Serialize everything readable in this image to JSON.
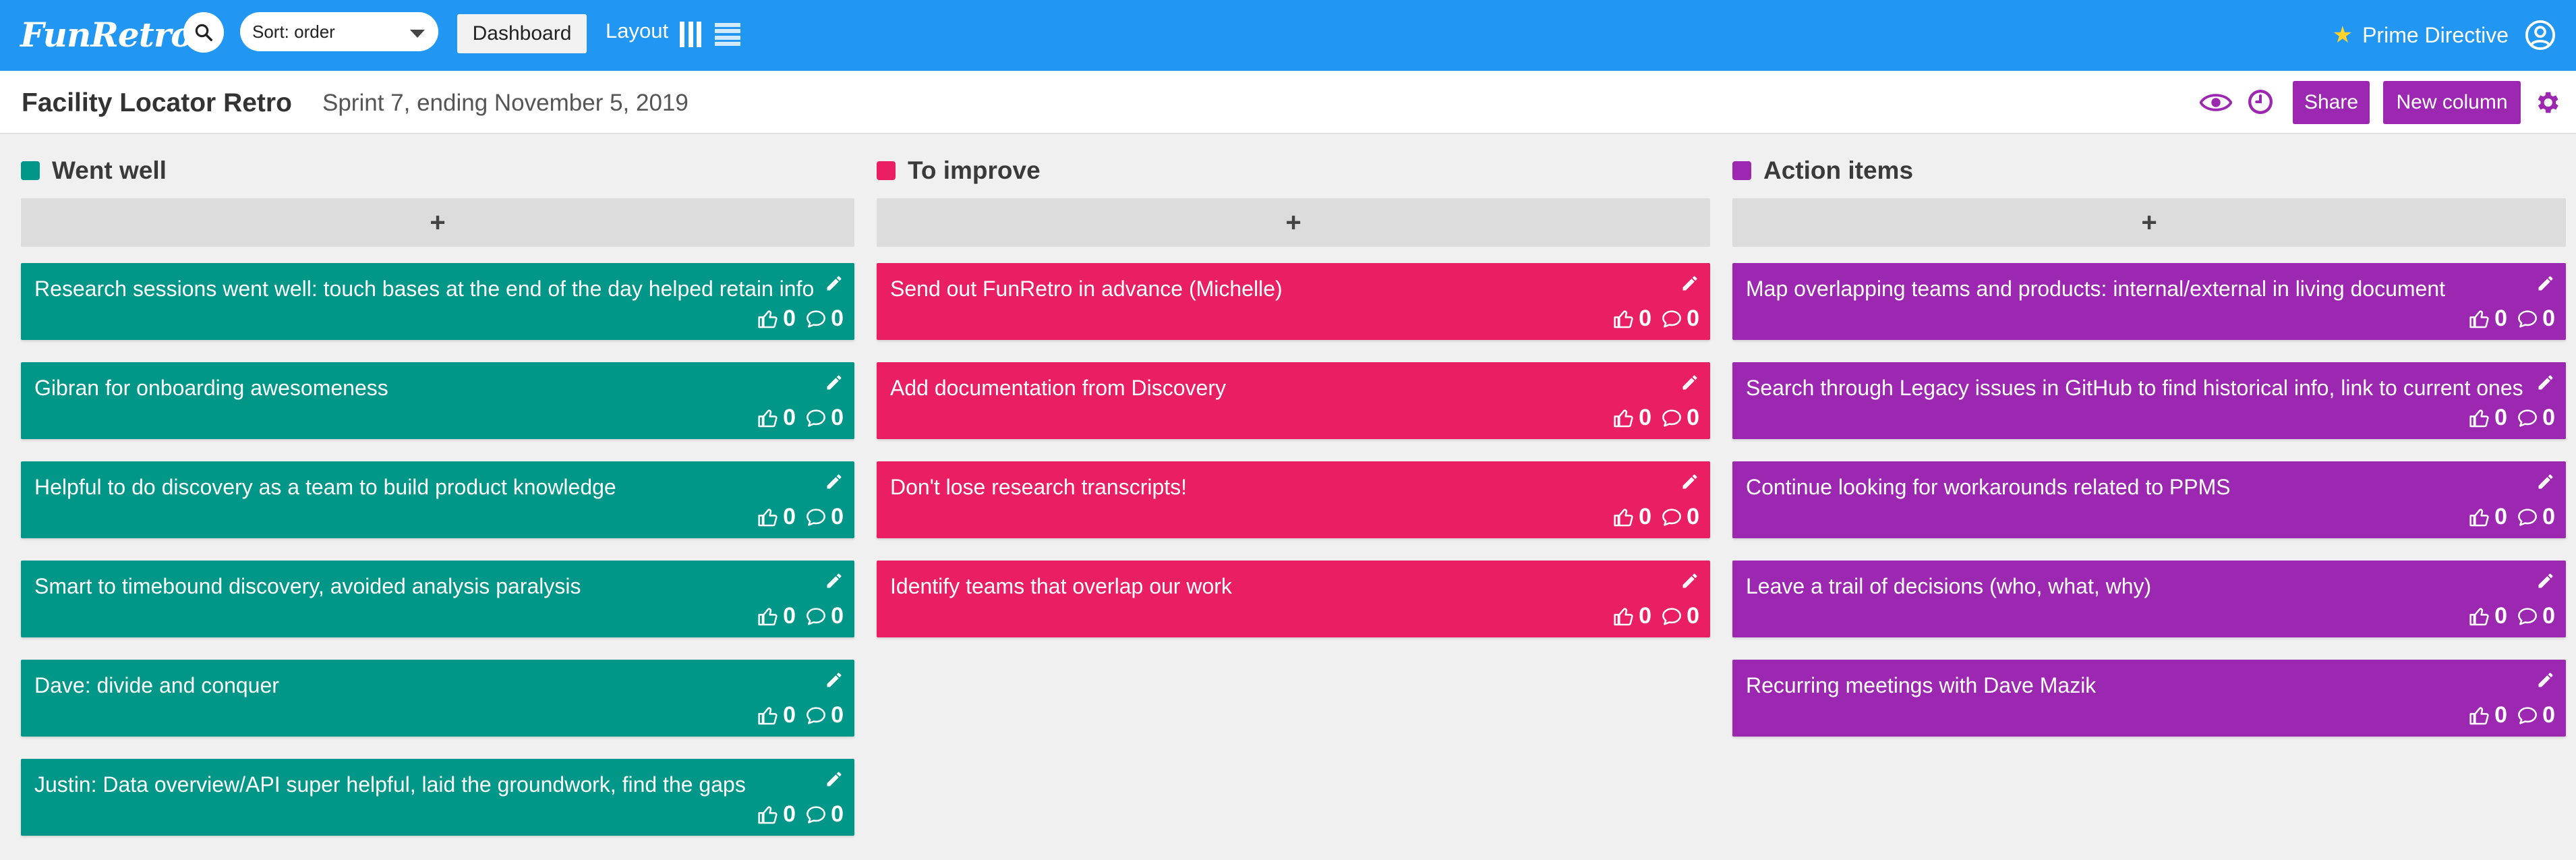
{
  "app": {
    "logo": "FunRetro",
    "sort_value": "Sort: order",
    "dashboard_label": "Dashboard",
    "layout_label": "Layout",
    "prime_directive_label": "Prime Directive"
  },
  "board": {
    "title": "Facility Locator Retro",
    "subtitle": "Sprint 7, ending November 5, 2019",
    "share_label": "Share",
    "new_column_label": "New column"
  },
  "colors": {
    "topbar": "#2196f3",
    "went_well": "#009688",
    "to_improve": "#e91e63",
    "action_items": "#9c27b0"
  },
  "columns": [
    {
      "title": "Went well",
      "color": "#009688",
      "add_label": "+",
      "cards": [
        {
          "text": "Research sessions went well: touch bases at the end of the day helped retain info",
          "votes": "0",
          "comments": "0"
        },
        {
          "text": "Gibran for onboarding awesomeness",
          "votes": "0",
          "comments": "0"
        },
        {
          "text": "Helpful to do discovery as a team to build product knowledge",
          "votes": "0",
          "comments": "0"
        },
        {
          "text": "Smart to timebound discovery, avoided analysis paralysis",
          "votes": "0",
          "comments": "0"
        },
        {
          "text": "Dave: divide and conquer",
          "votes": "0",
          "comments": "0"
        },
        {
          "text": "Justin: Data overview/API super helpful, laid the groundwork, find the gaps",
          "votes": "0",
          "comments": "0"
        }
      ]
    },
    {
      "title": "To improve",
      "color": "#e91e63",
      "add_label": "+",
      "cards": [
        {
          "text": "Send out FunRetro in advance (Michelle)",
          "votes": "0",
          "comments": "0"
        },
        {
          "text": "Add documentation from Discovery",
          "votes": "0",
          "comments": "0"
        },
        {
          "text": "Don't lose research transcripts!",
          "votes": "0",
          "comments": "0"
        },
        {
          "text": "Identify teams that overlap our work",
          "votes": "0",
          "comments": "0"
        }
      ]
    },
    {
      "title": "Action items",
      "color": "#9c27b0",
      "add_label": "+",
      "cards": [
        {
          "text": "Map overlapping teams and products: internal/external in living document",
          "votes": "0",
          "comments": "0"
        },
        {
          "text": "Search through Legacy issues in GitHub to find historical info, link to current ones",
          "votes": "0",
          "comments": "0"
        },
        {
          "text": "Continue looking for workarounds related to PPMS",
          "votes": "0",
          "comments": "0"
        },
        {
          "text": "Leave a trail of decisions (who, what, why)",
          "votes": "0",
          "comments": "0"
        },
        {
          "text": "Recurring meetings with Dave Mazik",
          "votes": "0",
          "comments": "0"
        }
      ]
    }
  ]
}
